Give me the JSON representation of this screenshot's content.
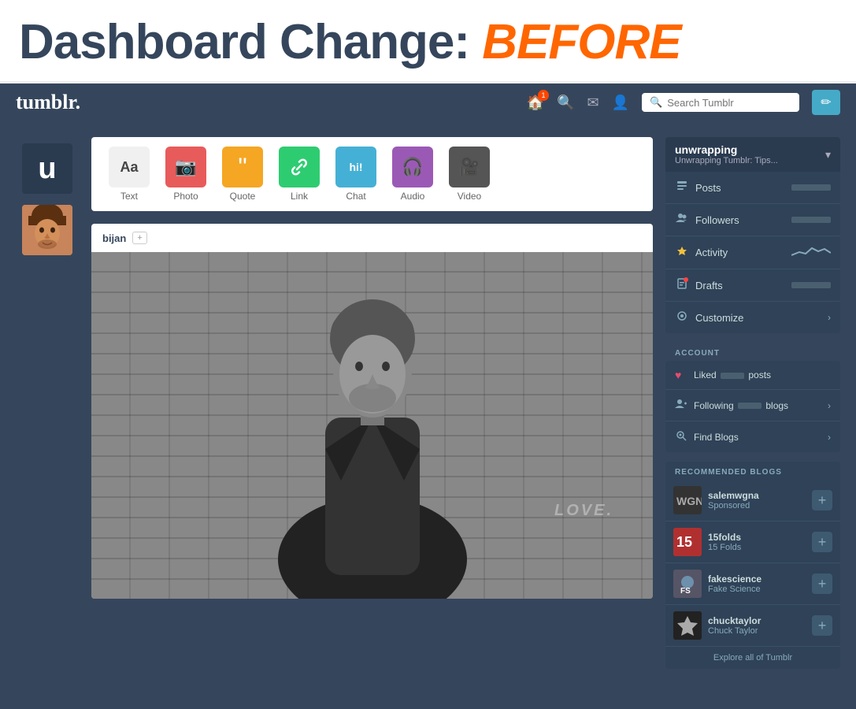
{
  "banner": {
    "title_prefix": "Dashboard Change:",
    "title_highlight": "BEFORE"
  },
  "navbar": {
    "logo": "tumblr.",
    "search_placeholder": "Search Tumblr",
    "home_badge": "1",
    "edit_icon": "✏"
  },
  "post_types": [
    {
      "id": "text",
      "label": "Text",
      "icon": "Aa",
      "color_class": "icon-text"
    },
    {
      "id": "photo",
      "label": "Photo",
      "icon": "📷",
      "color_class": "icon-photo"
    },
    {
      "id": "quote",
      "label": "Quote",
      "icon": "❝",
      "color_class": "icon-quote"
    },
    {
      "id": "link",
      "label": "Link",
      "icon": "🔗",
      "color_class": "icon-link"
    },
    {
      "id": "chat",
      "label": "Chat",
      "icon": "hi!",
      "color_class": "icon-chat"
    },
    {
      "id": "audio",
      "label": "Audio",
      "icon": "🎧",
      "color_class": "icon-audio"
    },
    {
      "id": "video",
      "label": "Video",
      "icon": "🎥",
      "color_class": "icon-video"
    }
  ],
  "blog": {
    "initial": "u",
    "name": "unwrapping",
    "subtitle": "Unwrapping Tumblr: Tips..."
  },
  "sidebar_menu": [
    {
      "id": "posts",
      "label": "Posts",
      "icon": "📄",
      "has_value": true
    },
    {
      "id": "followers",
      "label": "Followers",
      "has_value": true,
      "icon": "👥"
    },
    {
      "id": "activity",
      "label": "Activity",
      "has_chart": true,
      "icon": "⚡"
    },
    {
      "id": "drafts",
      "label": "Drafts",
      "has_value": true,
      "icon": "⬜"
    },
    {
      "id": "customize",
      "label": "Customize",
      "has_chevron": true,
      "icon": "👁"
    }
  ],
  "account_section": {
    "title": "ACCOUNT",
    "items": [
      {
        "id": "liked",
        "label_prefix": "Liked",
        "label_suffix": "posts",
        "has_blur": true
      },
      {
        "id": "following",
        "label_prefix": "Following",
        "label_suffix": "blogs",
        "has_blur": true,
        "has_chevron": true
      },
      {
        "id": "find-blogs",
        "label": "Find Blogs",
        "has_chevron": true
      }
    ]
  },
  "recommended": {
    "title": "RECOMMENDED BLOGS",
    "items": [
      {
        "id": "salemwgna",
        "name": "salemwgna",
        "sub": "Sponsored",
        "bg": "#333"
      },
      {
        "id": "15folds",
        "name": "15folds",
        "sub": "15 Folds",
        "bg": "#c44"
      },
      {
        "id": "fakescience",
        "name": "fakescience",
        "sub": "Fake Science",
        "bg": "#555"
      },
      {
        "id": "chucktaylor",
        "name": "chucktaylor",
        "sub": "Chuck Taylor",
        "bg": "#222"
      }
    ],
    "explore": "Explore all of Tumblr"
  },
  "feed_post": {
    "username": "bijan",
    "follow_label": "+",
    "love_text": "LOVE."
  }
}
